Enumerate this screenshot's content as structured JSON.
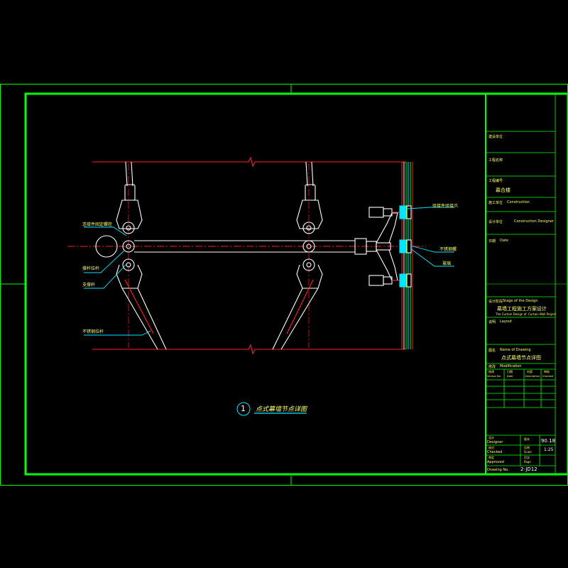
{
  "colors": {
    "background": "#000000",
    "frame": "#00ff00",
    "red": "#ff2020",
    "white": "#ffffff",
    "cyan": "#00e5ff",
    "yellow": "#ffff66",
    "green_text": "#00ff66"
  },
  "drawing": {
    "callouts": {
      "connector": "连接件固定螺栓",
      "pin_rod": "撑杆拉杆",
      "strut": "支撑杆",
      "cable": "不锈钢拉杆",
      "spider": "驳接件驳接爪",
      "bolt": "不锈钢螺",
      "glass": "玻璃"
    },
    "detail_number": "1",
    "detail_title": "点式幕墙节点详图"
  },
  "title_block": {
    "client": "建设单位",
    "project_label": "工程名称",
    "project_no_label": "工程编号",
    "project_no_value": "幕合楼",
    "construction_label": "施工单位",
    "construction_value": "Construction",
    "designer_label": "设计单位",
    "designer_value": "Construction Designer",
    "date_label": "日期",
    "date_value": "Date",
    "stage_label": "设计阶段",
    "stage_en": "Stage of the Design",
    "stage_cn": "幕墙工程施工方案设计",
    "stage_sub": "The Curtain Design of ·Curtain Wall Project",
    "layout_label": "说明",
    "layout_value": "Layout",
    "name_label": "图名",
    "name_en": "Name of Drawing",
    "name_cn": "点式幕墙节点详图",
    "mod_label": "修改",
    "mod_value": "Modification",
    "mod_cols": [
      "修改",
      "日期",
      "内容",
      "审核"
    ],
    "mod_cols_en": [
      "Version No.",
      "Date",
      "Description",
      "Checked"
    ],
    "designer_sig": "设计",
    "designer_sig_en": "Designer",
    "checked": "校对",
    "checked_en": "Checked",
    "approved": "审定",
    "approved_en": "Approved",
    "scale_label": "比例",
    "scale_en": "Scale",
    "scale_value": "1:25",
    "page_label": "页次",
    "page_en": "Page",
    "ver_label": "版本",
    "ver_value": "90.18",
    "drawing_no_label": "Drawing No.",
    "drawing_no_value": "2-JD12"
  }
}
